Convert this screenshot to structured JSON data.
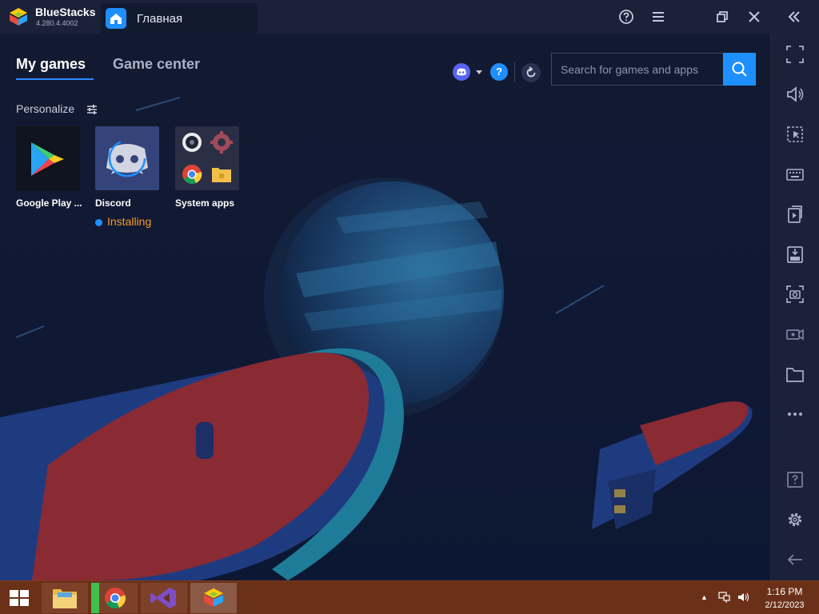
{
  "app": {
    "name": "BlueStacks",
    "version": "4.280.4.4002",
    "home_tab_label": "Главная"
  },
  "tabs": {
    "my_games": "My games",
    "game_center": "Game center"
  },
  "search": {
    "placeholder": "Search for games and apps"
  },
  "help_glyph": "?",
  "personalize_label": "Personalize",
  "games": [
    {
      "name": "Google Play ...",
      "icon": "google-play-icon"
    },
    {
      "name": "Discord",
      "icon": "discord-icon",
      "status": "Installing"
    },
    {
      "name": "System apps",
      "icon": "system-apps-icon"
    }
  ],
  "sidebar_icons": [
    "fullscreen-icon",
    "volume-icon",
    "selection-icon",
    "keyboard-icon",
    "media-icon",
    "apk-icon",
    "screenshot-icon",
    "record-icon",
    "folder-icon",
    "more-icon",
    "help-icon",
    "settings-icon",
    "back-icon"
  ],
  "taskbar": {
    "time": "1:16 PM",
    "date": "2/12/2023",
    "tray_expand_glyph": "▲",
    "apps": [
      "file-explorer-icon",
      "chrome-icon",
      "visual-studio-icon",
      "bluestacks-icon"
    ]
  },
  "colors": {
    "accent": "#1e8fff",
    "status": "#f39a2b",
    "taskbar": "#6b3118"
  }
}
